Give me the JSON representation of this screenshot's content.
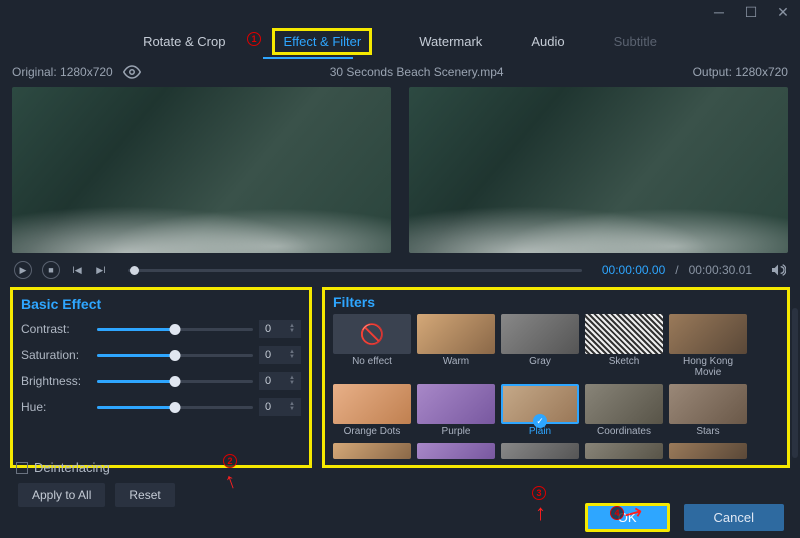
{
  "window": {
    "tabs": [
      {
        "label": "Rotate & Crop",
        "state": "normal"
      },
      {
        "label": "Effect & Filter",
        "state": "active"
      },
      {
        "label": "Watermark",
        "state": "normal"
      },
      {
        "label": "Audio",
        "state": "normal"
      },
      {
        "label": "Subtitle",
        "state": "disabled"
      }
    ]
  },
  "preview": {
    "original_label": "Original: 1280x720",
    "filename": "30 Seconds Beach Scenery.mp4",
    "output_label": "Output: 1280x720"
  },
  "playback": {
    "current_time": "00:00:00.00",
    "separator": "/",
    "duration": "00:00:30.01"
  },
  "basic_effect": {
    "title": "Basic Effect",
    "sliders": [
      {
        "label": "Contrast:",
        "value": "0"
      },
      {
        "label": "Saturation:",
        "value": "0"
      },
      {
        "label": "Brightness:",
        "value": "0"
      },
      {
        "label": "Hue:",
        "value": "0"
      }
    ],
    "deinterlacing_label": "Deinterlacing",
    "apply_all_label": "Apply to All",
    "reset_label": "Reset"
  },
  "filters": {
    "title": "Filters",
    "items": [
      {
        "label": "No effect",
        "cls": "noeffect"
      },
      {
        "label": "Warm",
        "cls": "warm"
      },
      {
        "label": "Gray",
        "cls": "gray"
      },
      {
        "label": "Sketch",
        "cls": "sketch"
      },
      {
        "label": "Hong Kong Movie",
        "cls": "hk"
      },
      {
        "label": "Orange Dots",
        "cls": "orange"
      },
      {
        "label": "Purple",
        "cls": "purple"
      },
      {
        "label": "Plain",
        "cls": "plain",
        "selected": true
      },
      {
        "label": "Coordinates",
        "cls": "coords"
      },
      {
        "label": "Stars",
        "cls": "stars"
      }
    ]
  },
  "footer": {
    "ok_label": "OK",
    "cancel_label": "Cancel"
  },
  "callouts": {
    "c1": "1",
    "c2": "2",
    "c3": "3",
    "c4": "4"
  }
}
